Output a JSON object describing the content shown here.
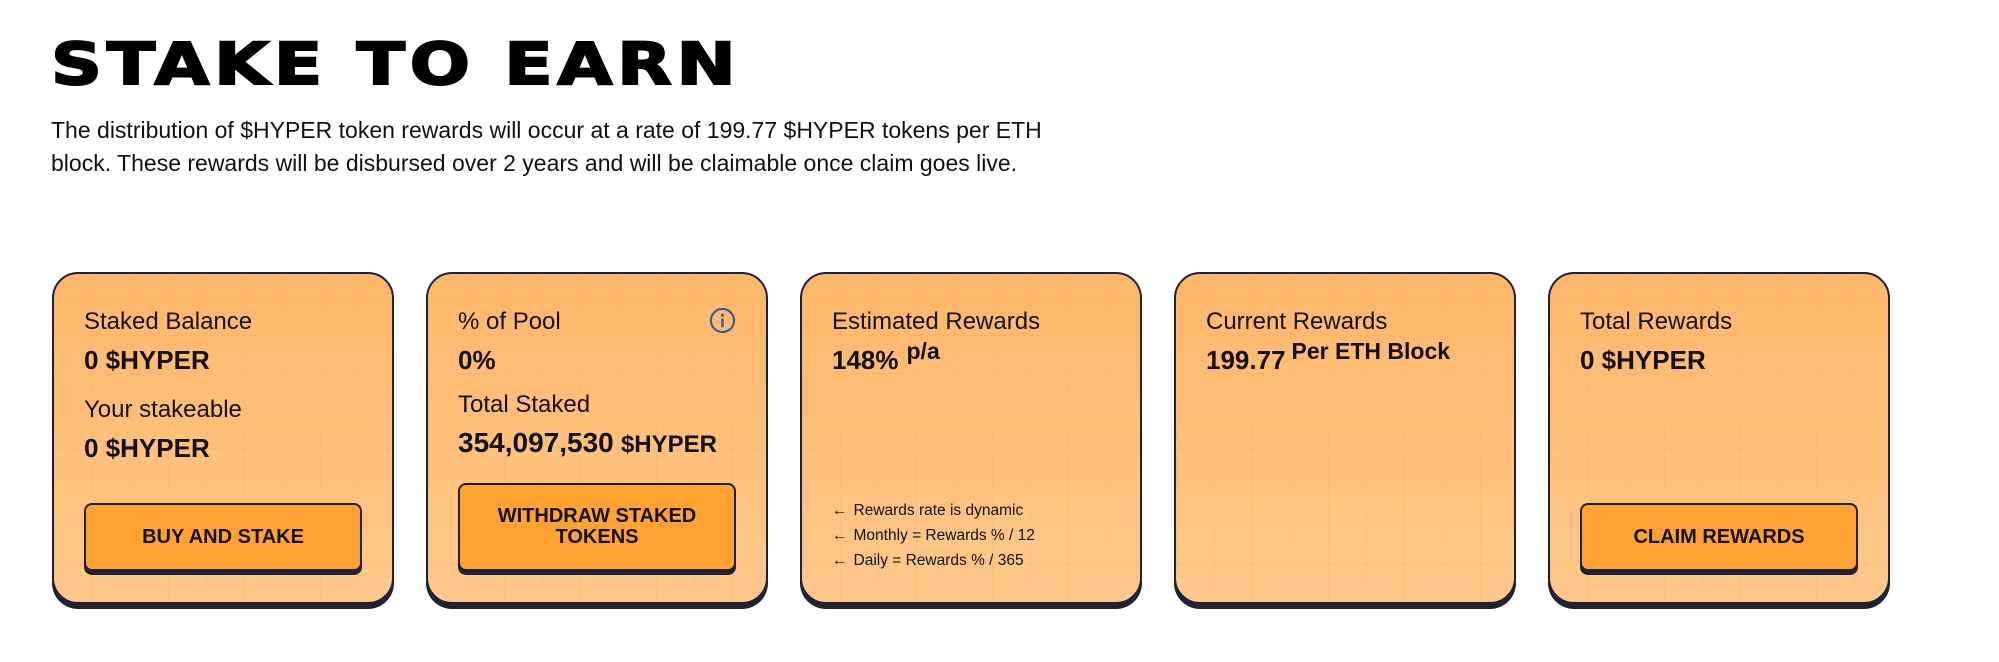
{
  "page": {
    "title": "STAKE TO EARN",
    "intro_line1": "The distribution of $HYPER token rewards will occur at a rate of 199.77 $HYPER tokens per ETH",
    "intro_line2": "block. These rewards will be disbursed over 2 years and will be claimable once claim goes live."
  },
  "cards": {
    "staked_balance": {
      "label": "Staked Balance",
      "value": "0 $HYPER",
      "stakeable_label": "Your stakeable",
      "stakeable_value": "0 $HYPER",
      "button_label": "BUY AND STAKE"
    },
    "pool": {
      "label": "% of Pool",
      "value": "0%",
      "info_icon": "info-circle-icon",
      "total_staked_label": "Total Staked",
      "total_staked_amount": "354,097,530",
      "total_staked_unit": "$HYPER",
      "button_label": "WITHDRAW STAKED TOKENS"
    },
    "estimated_rewards": {
      "label": "Estimated Rewards",
      "value": "148%",
      "suffix": "p/a",
      "notes": [
        "Rewards rate is dynamic",
        "Monthly = Rewards % / 12",
        "Daily = Rewards % / 365"
      ],
      "note_arrow": "←"
    },
    "current_rewards": {
      "label": "Current Rewards",
      "value": "199.77",
      "suffix": "Per ETH Block"
    },
    "total_rewards": {
      "label": "Total Rewards",
      "value": "0 $HYPER",
      "button_label": "CLAIM REWARDS"
    }
  },
  "colors": {
    "card_fill": "#ffc789",
    "button_fill": "#ffa231",
    "border": "#1f2234",
    "info_icon": "#2f5aa8"
  }
}
